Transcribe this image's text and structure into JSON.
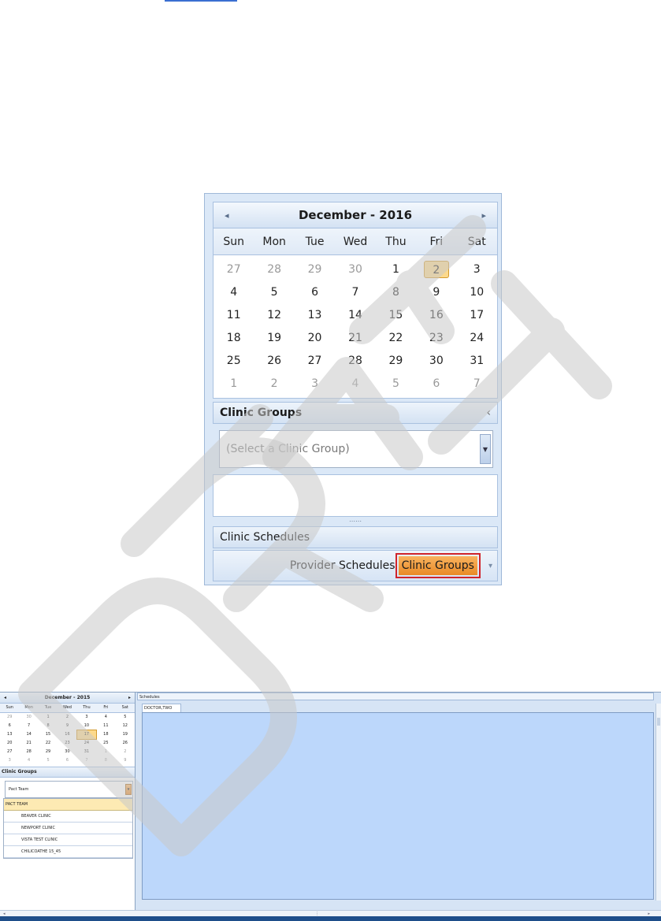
{
  "calendar": {
    "month_title": "December - 2016",
    "prev_icon": "chevron-left-icon",
    "next_icon": "chevron-right-icon",
    "weekdays": [
      "Sun",
      "Mon",
      "Tue",
      "Wed",
      "Thu",
      "Fri",
      "Sat"
    ],
    "days": [
      {
        "d": "27",
        "muted": true
      },
      {
        "d": "28",
        "muted": true
      },
      {
        "d": "29",
        "muted": true
      },
      {
        "d": "30",
        "muted": true
      },
      {
        "d": "1"
      },
      {
        "d": "2",
        "selected": true
      },
      {
        "d": "3"
      },
      {
        "d": "4"
      },
      {
        "d": "5"
      },
      {
        "d": "6"
      },
      {
        "d": "7"
      },
      {
        "d": "8"
      },
      {
        "d": "9"
      },
      {
        "d": "10"
      },
      {
        "d": "11"
      },
      {
        "d": "12"
      },
      {
        "d": "13"
      },
      {
        "d": "14"
      },
      {
        "d": "15"
      },
      {
        "d": "16"
      },
      {
        "d": "17"
      },
      {
        "d": "18"
      },
      {
        "d": "19"
      },
      {
        "d": "20"
      },
      {
        "d": "21"
      },
      {
        "d": "22"
      },
      {
        "d": "23"
      },
      {
        "d": "24"
      },
      {
        "d": "25"
      },
      {
        "d": "26"
      },
      {
        "d": "27"
      },
      {
        "d": "28"
      },
      {
        "d": "29"
      },
      {
        "d": "30"
      },
      {
        "d": "31"
      },
      {
        "d": "1",
        "muted": true
      },
      {
        "d": "2",
        "muted": true
      },
      {
        "d": "3",
        "muted": true
      },
      {
        "d": "4",
        "muted": true
      },
      {
        "d": "5",
        "muted": true
      },
      {
        "d": "6",
        "muted": true
      },
      {
        "d": "7",
        "muted": true
      }
    ]
  },
  "clinic_groups": {
    "title": "Clinic Groups",
    "collapse_glyph": "‹",
    "placeholder": "(Select a Clinic Group)",
    "splitter_glyph": "⋯⋯"
  },
  "clinic_schedules": {
    "title": "Clinic Schedules"
  },
  "bottom_bar": {
    "provider_label": "Provider Schedules",
    "clinic_groups_label": "Clinic Groups",
    "more_glyph": "▾"
  },
  "app": {
    "calendar": {
      "month_title": "December - 2015",
      "weekdays": [
        "Sun",
        "Mon",
        "Tue",
        "Wed",
        "Thu",
        "Fri",
        "Sat"
      ],
      "days": [
        {
          "d": "29",
          "muted": true
        },
        {
          "d": "30",
          "muted": true
        },
        {
          "d": "1"
        },
        {
          "d": "2"
        },
        {
          "d": "3"
        },
        {
          "d": "4"
        },
        {
          "d": "5"
        },
        {
          "d": "6"
        },
        {
          "d": "7"
        },
        {
          "d": "8"
        },
        {
          "d": "9"
        },
        {
          "d": "10"
        },
        {
          "d": "11"
        },
        {
          "d": "12"
        },
        {
          "d": "13"
        },
        {
          "d": "14"
        },
        {
          "d": "15"
        },
        {
          "d": "16"
        },
        {
          "d": "17",
          "selected": true
        },
        {
          "d": "18"
        },
        {
          "d": "19"
        },
        {
          "d": "20"
        },
        {
          "d": "21"
        },
        {
          "d": "22"
        },
        {
          "d": "23"
        },
        {
          "d": "24"
        },
        {
          "d": "25"
        },
        {
          "d": "26"
        },
        {
          "d": "27"
        },
        {
          "d": "28"
        },
        {
          "d": "29"
        },
        {
          "d": "30"
        },
        {
          "d": "31"
        },
        {
          "d": "1",
          "muted": true
        },
        {
          "d": "2",
          "muted": true
        },
        {
          "d": "3",
          "muted": true
        },
        {
          "d": "4",
          "muted": true
        },
        {
          "d": "5",
          "muted": true
        },
        {
          "d": "6",
          "muted": true
        },
        {
          "d": "7",
          "muted": true
        },
        {
          "d": "8",
          "muted": true
        },
        {
          "d": "9",
          "muted": true
        }
      ]
    },
    "clinic_groups_title": "Clinic Groups",
    "search_value": "Pact Team",
    "group_header": "PACT TEAM",
    "clinics": [
      "BEAVER CLINIC",
      "NEWPORT CLINIC",
      "VISTA TEST CLINIC",
      "CHILICOATHE 15_45"
    ],
    "schedules_label": "Schedules",
    "tab_label": "DOCTOR,TWO"
  }
}
